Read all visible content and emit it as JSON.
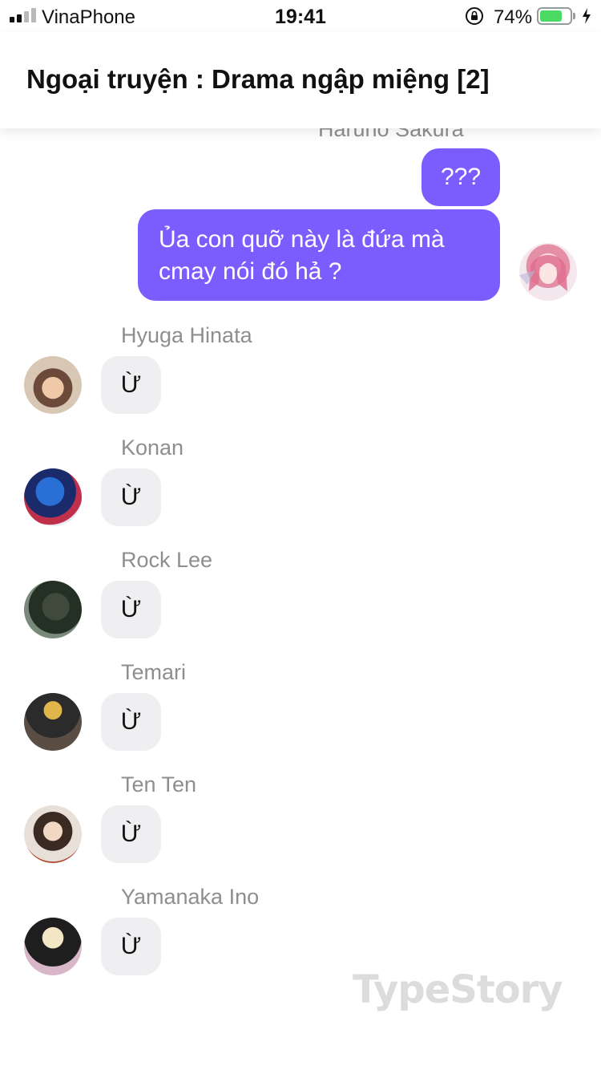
{
  "status_bar": {
    "carrier": "VinaPhone",
    "time": "19:41",
    "battery_percent": "74%",
    "battery_level": 0.74,
    "signal_bars_active": 2
  },
  "header": {
    "title": "Ngoại truyện : Drama ngập miệng [2]"
  },
  "colors": {
    "outgoing_bubble": "#7b5cff",
    "incoming_bubble": "#efeff1",
    "sender_name": "#8e8e8e",
    "battery": "#4cd964"
  },
  "messages": {
    "outgoing_sender": "Haruno Sakura",
    "outgoing": [
      {
        "text": "???"
      },
      {
        "line1": "Ủa con quỡ này là đứa mà",
        "line2": "cmay nói đó hả ?"
      }
    ],
    "incoming": [
      {
        "sender": "Hyuga Hinata",
        "text": "Ừ"
      },
      {
        "sender": "Konan",
        "text": "Ừ"
      },
      {
        "sender": "Rock Lee",
        "text": "Ừ"
      },
      {
        "sender": "Temari",
        "text": "Ừ"
      },
      {
        "sender": "Ten Ten",
        "text": "Ừ"
      },
      {
        "sender": "Yamanaka Ino",
        "text": "Ừ"
      }
    ]
  },
  "watermark": "TypeStory"
}
